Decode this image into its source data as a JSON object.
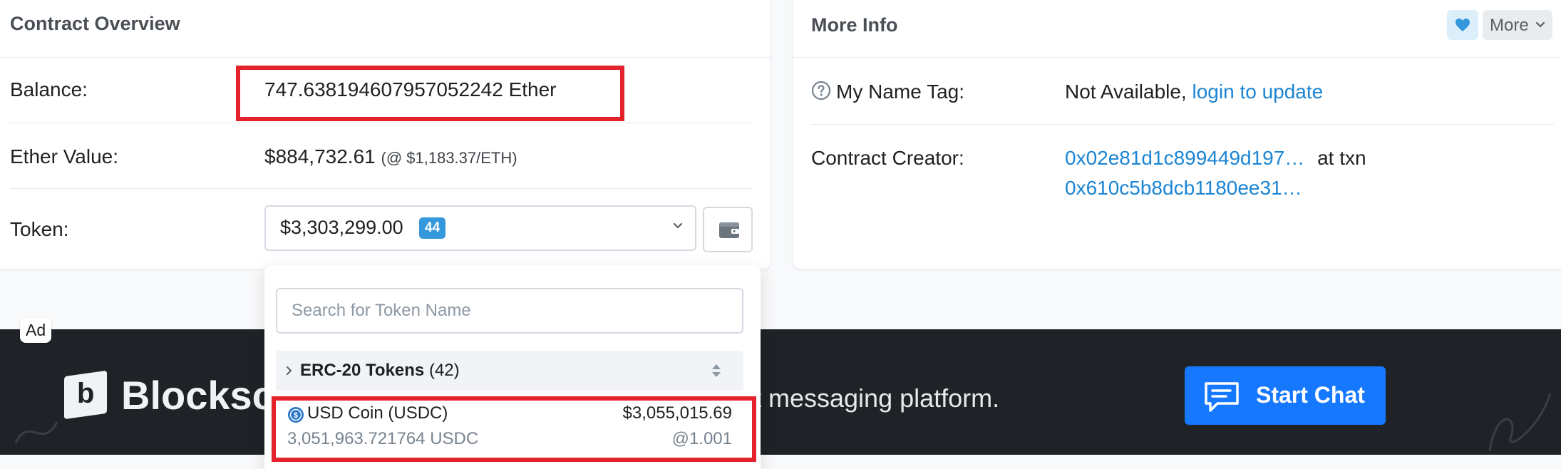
{
  "overview": {
    "title": "Contract Overview",
    "balance_label": "Balance:",
    "balance_value": "747.638194607957052242 Ether",
    "ether_value_label": "Ether Value:",
    "ether_value": "$884,732.61",
    "ether_rate": "(@ $1,183.37/ETH)",
    "token_label": "Token:",
    "token_total": "$3,303,299.00",
    "token_count": "44"
  },
  "more_info": {
    "title": "More Info",
    "more_button": "More",
    "name_tag_label": "My Name Tag:",
    "name_tag_value": "Not Available,",
    "name_tag_link": "login to update",
    "creator_label": "Contract Creator:",
    "creator_address": "0x02e81d1c899449d197…",
    "creator_at_txn": "at txn",
    "creator_txn": "0x610c5b8dcb1180ee31…"
  },
  "dropdown": {
    "search_placeholder": "Search for Token Name",
    "group_name": "ERC-20 Tokens",
    "group_count": "(42)",
    "token": {
      "name": "USD Coin (USDC)",
      "value": "$3,055,015.69",
      "quantity": "3,051,963.721764 USDC",
      "rate": "@1.001"
    }
  },
  "ad": {
    "badge": "Ad",
    "brand": "Blocksc",
    "tagline": "t messaging platform.",
    "cta_label": "Start Chat"
  },
  "colors": {
    "link": "#1b85d4",
    "badge": "#3498db",
    "highlight": "#e4222b",
    "cta": "#1677ff",
    "ad_bg": "#1f2227"
  }
}
